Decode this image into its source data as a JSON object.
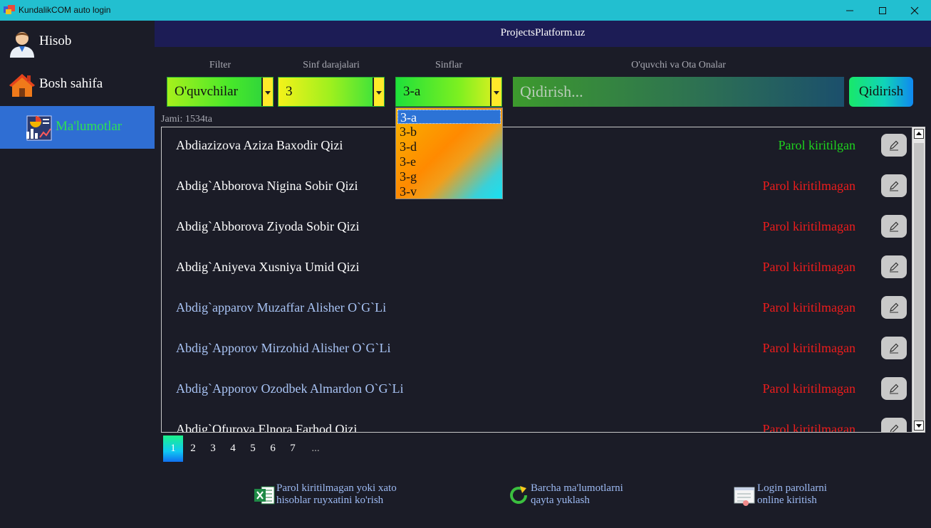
{
  "window": {
    "title": "KundalikCOM auto login"
  },
  "sidebar": {
    "items": [
      {
        "label": "Hisob",
        "icon": "user-icon",
        "active": false
      },
      {
        "label": "Bosh sahifa",
        "icon": "home-icon",
        "active": false
      },
      {
        "label": "Ma'lumotlar",
        "icon": "chart-icon",
        "active": true
      }
    ]
  },
  "header": {
    "site": "ProjectsPlatform.uz"
  },
  "filters": {
    "filter": {
      "label": "Filter",
      "value": "O'quvchilar"
    },
    "grade": {
      "label": "Sinf darajalari",
      "value": "3"
    },
    "class": {
      "label": "Sinflar",
      "value": "3-a",
      "options": [
        "3-a",
        "3-b",
        "3-d",
        "3-e",
        "3-g",
        "3-v"
      ],
      "selected": "3-a"
    },
    "search": {
      "label": "O'quvchi va Ota Onalar",
      "placeholder": "Qidirish...",
      "value": ""
    },
    "search_button": "Qidirish"
  },
  "total": "Jami: 1534ta",
  "students": [
    {
      "name": "Abdiazizova Aziza Baxodir Qizi",
      "status": "Parol kiritilgan",
      "status_color": "#1ed41e",
      "name_color": "#ffffff"
    },
    {
      "name": "Abdig`Abborova Nigina Sobir Qizi",
      "status": "Parol kiritilmagan",
      "status_color": "#ee1c1c",
      "name_color": "#ffffff"
    },
    {
      "name": "Abdig`Abborova Ziyoda Sobir Qizi",
      "status": "Parol kiritilmagan",
      "status_color": "#ee1c1c",
      "name_color": "#ffffff"
    },
    {
      "name": "Abdig`Aniyeva Xusniya Umid Qizi",
      "status": "Parol kiritilmagan",
      "status_color": "#ee1c1c",
      "name_color": "#ffffff"
    },
    {
      "name": "Abdig`apparov Muzaffar Alisher O`G`Li",
      "status": "Parol kiritilmagan",
      "status_color": "#ee1c1c",
      "name_color": "#a9c4f5"
    },
    {
      "name": "Abdig`Apporov Mirzohid Alisher O`G`Li",
      "status": "Parol kiritilmagan",
      "status_color": "#ee1c1c",
      "name_color": "#a9c4f5"
    },
    {
      "name": "Abdig`Apporov Ozodbek Almardon O`G`Li",
      "status": "Parol kiritilmagan",
      "status_color": "#ee1c1c",
      "name_color": "#a9c4f5"
    },
    {
      "name": "Abdig`Ofurova Elnora Farhod Qizi",
      "status": "Parol kiritilmagan",
      "status_color": "#ee1c1c",
      "name_color": "#ffffff"
    }
  ],
  "pagination": {
    "pages": [
      "1",
      "2",
      "3",
      "4",
      "5",
      "6",
      "7",
      "..."
    ],
    "current": "1"
  },
  "actions": [
    {
      "line1": "Parol kiritilmagan yoki xato",
      "line2": "hisoblar ruyxatini ko'rish",
      "icon": "excel-icon"
    },
    {
      "line1": "Barcha ma'lumotlarni",
      "line2": "qayta yuklash",
      "icon": "refresh-icon"
    },
    {
      "line1": "Login parollarni",
      "line2": "online kiritish",
      "icon": "form-icon"
    }
  ]
}
